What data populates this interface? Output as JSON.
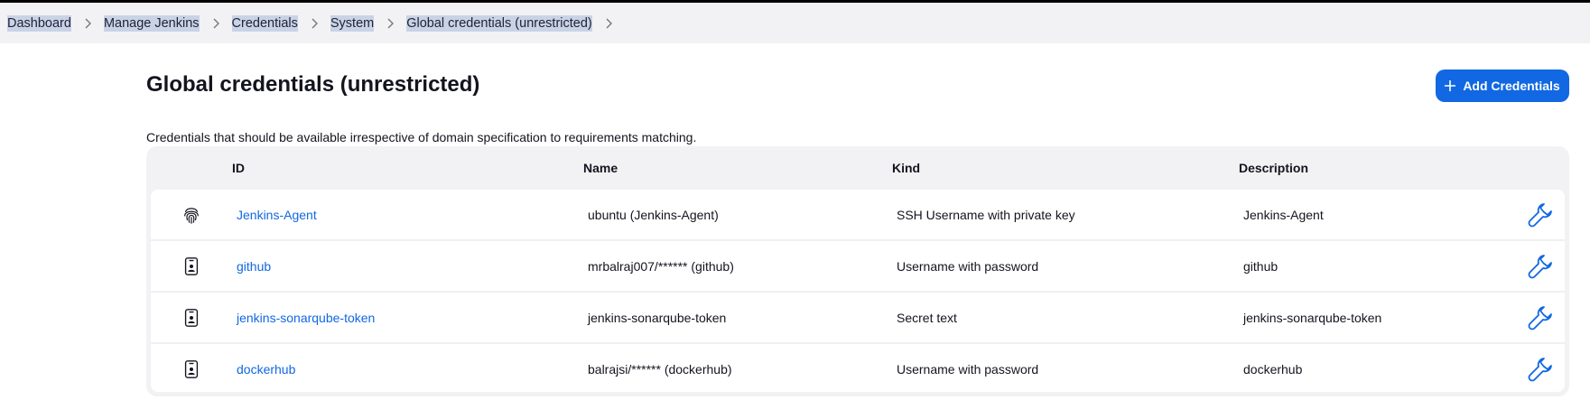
{
  "breadcrumb": [
    "Dashboard",
    "Manage Jenkins",
    "Credentials",
    "System",
    "Global credentials (unrestricted)"
  ],
  "page": {
    "title": "Global credentials (unrestricted)",
    "add_button_label": "Add Credentials",
    "description": "Credentials that should be available irrespective of domain specification to requirements matching."
  },
  "table": {
    "columns": [
      "ID",
      "Name",
      "Kind",
      "Description"
    ],
    "rows": [
      {
        "icon": "fingerprint-icon",
        "id": "Jenkins-Agent",
        "name": "ubuntu (Jenkins-Agent)",
        "kind": "SSH Username with private key",
        "description": "Jenkins-Agent"
      },
      {
        "icon": "id-badge-icon",
        "id": "github",
        "name": "mrbalraj007/****** (github)",
        "kind": "Username with password",
        "description": "github"
      },
      {
        "icon": "id-badge-icon",
        "id": "jenkins-sonarqube-token",
        "name": "jenkins-sonarqube-token",
        "kind": "Secret text",
        "description": "jenkins-sonarqube-token"
      },
      {
        "icon": "id-badge-icon",
        "id": "dockerhub",
        "name": "balrajsi/****** (dockerhub)",
        "kind": "Username with password",
        "description": "dockerhub"
      }
    ]
  },
  "colors": {
    "accent": "#1168e2",
    "header_bg": "#f2f2f4",
    "selection": "#c9d3e6"
  }
}
